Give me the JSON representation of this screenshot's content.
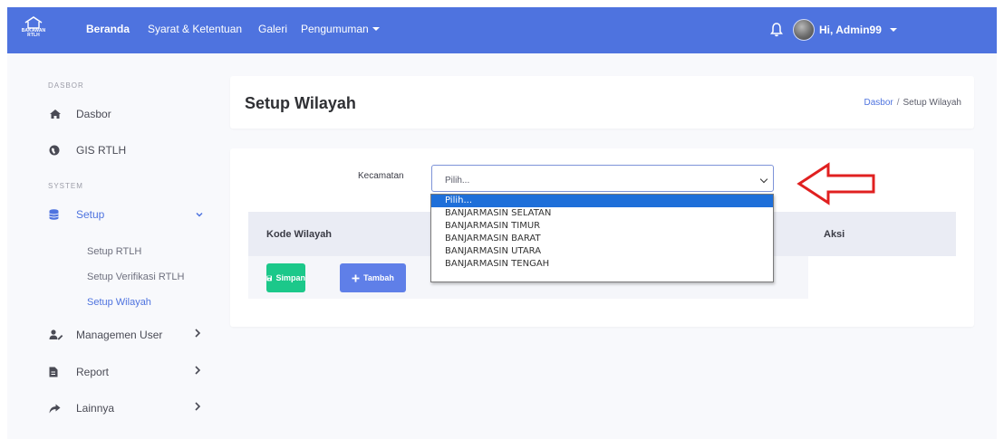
{
  "brand": {
    "text_line1": "BAKAWAN",
    "text_line2": "RTLH"
  },
  "topnav": {
    "items": [
      {
        "label": "Beranda"
      },
      {
        "label": "Syarat & Ketentuan"
      },
      {
        "label": "Galeri"
      },
      {
        "label": "Pengumuman"
      }
    ],
    "user_label": "Hi, Admin99"
  },
  "sidebar": {
    "heading_dasbor": "DASBOR",
    "heading_system": "SYSTEM",
    "items": {
      "dasbor": "Dasbor",
      "gis": "GIS RTLH",
      "setup": "Setup",
      "managemen_user": "Managemen User",
      "report": "Report",
      "lainnya": "Lainnya"
    },
    "setup_sub": [
      "Setup RTLH",
      "Setup Verifikasi RTLH",
      "Setup Wilayah"
    ]
  },
  "header": {
    "title": "Setup Wilayah",
    "breadcrumb": [
      "Dasbor",
      "Setup Wilayah"
    ]
  },
  "form": {
    "kecamatan_label": "Kecamatan",
    "select_value": "Pilih...",
    "options": [
      "Pilih...",
      "BANJARMASIN SELATAN",
      "BANJARMASIN TIMUR",
      "BANJARMASIN BARAT",
      "BANJARMASIN UTARA",
      "BANJARMASIN TENGAH"
    ]
  },
  "table": {
    "col_kode": "Kode Wilayah",
    "col_aksi": "Aksi",
    "btn_simpan": "Simpan",
    "btn_tambah": "Tambah"
  },
  "colors": {
    "primary": "#4e73df",
    "success": "#1cc88a",
    "annotation_arrow": "#e02020"
  }
}
